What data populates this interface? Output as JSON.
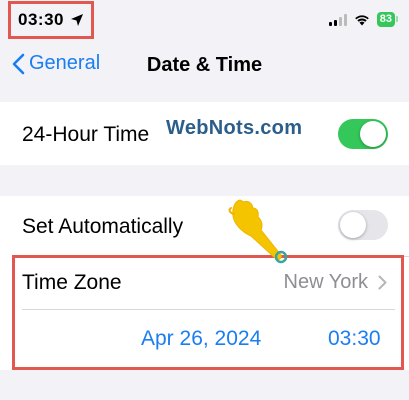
{
  "status_bar": {
    "time": "03:30",
    "battery": "83",
    "location_icon": "location-arrow-icon",
    "signal_icon": "cellular-signal-icon",
    "wifi_icon": "wifi-icon"
  },
  "nav": {
    "back_label": "General",
    "title": "Date & Time"
  },
  "settings": {
    "hour24": {
      "label": "24-Hour Time",
      "on": true
    },
    "set_automatically": {
      "label": "Set Automatically",
      "on": false
    },
    "time_zone": {
      "label": "Time Zone",
      "value": "New York"
    },
    "date": "Apr 26, 2024",
    "time": "03:30"
  },
  "watermark": "WebNots.com",
  "colors": {
    "accent": "#1a7ef2",
    "toggle_on": "#34c759",
    "toggle_off": "#e5e5ea",
    "annotation": "#e0584f",
    "pointer": "#f5c400"
  }
}
